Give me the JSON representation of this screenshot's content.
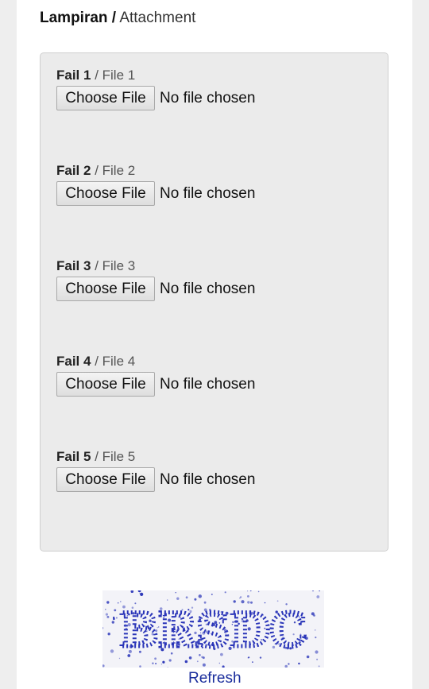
{
  "section": {
    "title_ms": "Lampiran /",
    "title_en": "Attachment"
  },
  "files": [
    {
      "label_ms": "Fail 1",
      "label_en": "/ File 1",
      "button": "Choose File",
      "status": "No file chosen"
    },
    {
      "label_ms": "Fail 2",
      "label_en": "/ File 2",
      "button": "Choose File",
      "status": "No file chosen"
    },
    {
      "label_ms": "Fail 3",
      "label_en": "/ File 3",
      "button": "Choose File",
      "status": "No file chosen"
    },
    {
      "label_ms": "Fail 4",
      "label_en": "/ File 4",
      "button": "Choose File",
      "status": "No file chosen"
    },
    {
      "label_ms": "Fail 5",
      "label_en": "/ File 5",
      "button": "Choose File",
      "status": "No file chosen"
    }
  ],
  "captcha": {
    "text": "BRSDC",
    "refresh_label": "Refresh",
    "text_color": "#2a35b8"
  }
}
